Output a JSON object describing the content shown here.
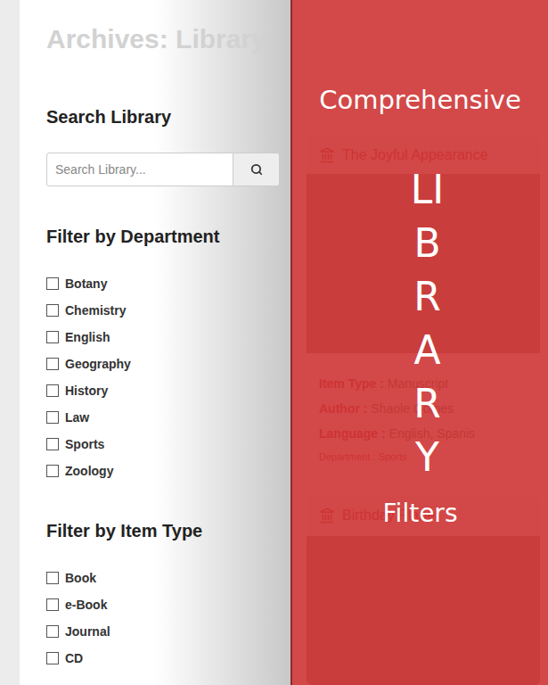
{
  "page": {
    "title": "Archives: Library"
  },
  "search": {
    "heading": "Search Library",
    "placeholder": "Search Library..."
  },
  "departments": {
    "heading": "Filter by Department",
    "items": [
      {
        "label": "Botany",
        "checked": false
      },
      {
        "label": "Chemistry",
        "checked": false
      },
      {
        "label": "English",
        "checked": false
      },
      {
        "label": "Geography",
        "checked": false
      },
      {
        "label": "History",
        "checked": false
      },
      {
        "label": "Law",
        "checked": false
      },
      {
        "label": "Sports",
        "checked": false
      },
      {
        "label": "Zoology",
        "checked": false
      }
    ]
  },
  "item_types": {
    "heading": "Filter by Item Type",
    "items": [
      {
        "label": "Book",
        "checked": false
      },
      {
        "label": "e-Book",
        "checked": false
      },
      {
        "label": "Journal",
        "checked": false
      },
      {
        "label": "CD",
        "checked": false
      }
    ]
  },
  "overlay": {
    "top": "Comprehensive",
    "vertical": "LIBRARY",
    "bottom": "Filters"
  },
  "cards": [
    {
      "title": "The Joyful Appearance",
      "fields": [
        {
          "label": "Item Type :",
          "value": "Manuscript"
        },
        {
          "label": "Author :",
          "value": "Shaole Gomes"
        },
        {
          "label": "Language :",
          "value": "English, Spanis"
        }
      ],
      "department": {
        "label": "Department :",
        "value": "Sports"
      }
    },
    {
      "title": "Birthday Planet",
      "fields": [],
      "department": null
    }
  ]
}
